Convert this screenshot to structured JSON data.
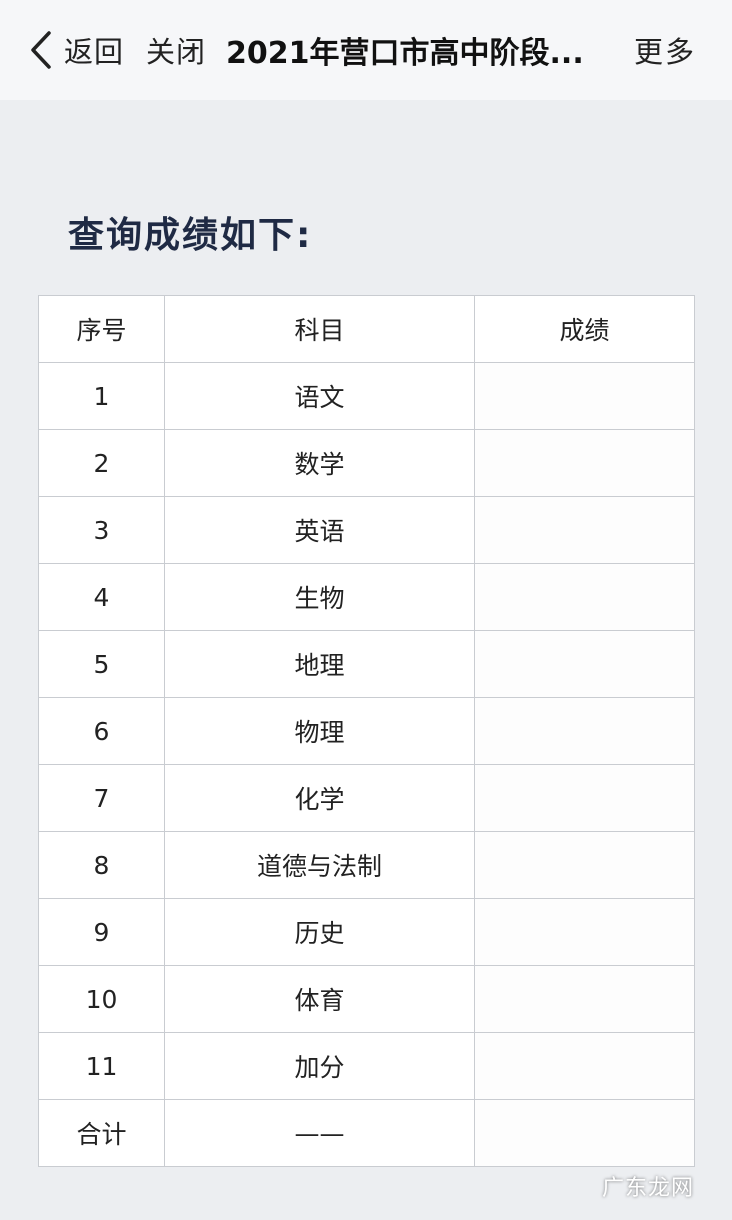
{
  "nav": {
    "back_label": "返回",
    "close_label": "关闭",
    "title": "2021年营口市高中阶段...",
    "more_label": "更多"
  },
  "heading": "查询成绩如下:",
  "table": {
    "headers": [
      "序号",
      "科目",
      "成绩"
    ],
    "rows": [
      {
        "idx": "1",
        "subject": "语文",
        "score": ""
      },
      {
        "idx": "2",
        "subject": "数学",
        "score": ""
      },
      {
        "idx": "3",
        "subject": "英语",
        "score": ""
      },
      {
        "idx": "4",
        "subject": "生物",
        "score": ""
      },
      {
        "idx": "5",
        "subject": "地理",
        "score": ""
      },
      {
        "idx": "6",
        "subject": "物理",
        "score": ""
      },
      {
        "idx": "7",
        "subject": "化学",
        "score": ""
      },
      {
        "idx": "8",
        "subject": "道德与法制",
        "score": ""
      },
      {
        "idx": "9",
        "subject": "历史",
        "score": ""
      },
      {
        "idx": "10",
        "subject": "体育",
        "score": ""
      },
      {
        "idx": "11",
        "subject": "加分",
        "score": ""
      },
      {
        "idx": "合计",
        "subject": "——",
        "score": ""
      }
    ]
  },
  "watermark": "广东龙网",
  "icons": {
    "back": "chevron-left-icon"
  }
}
